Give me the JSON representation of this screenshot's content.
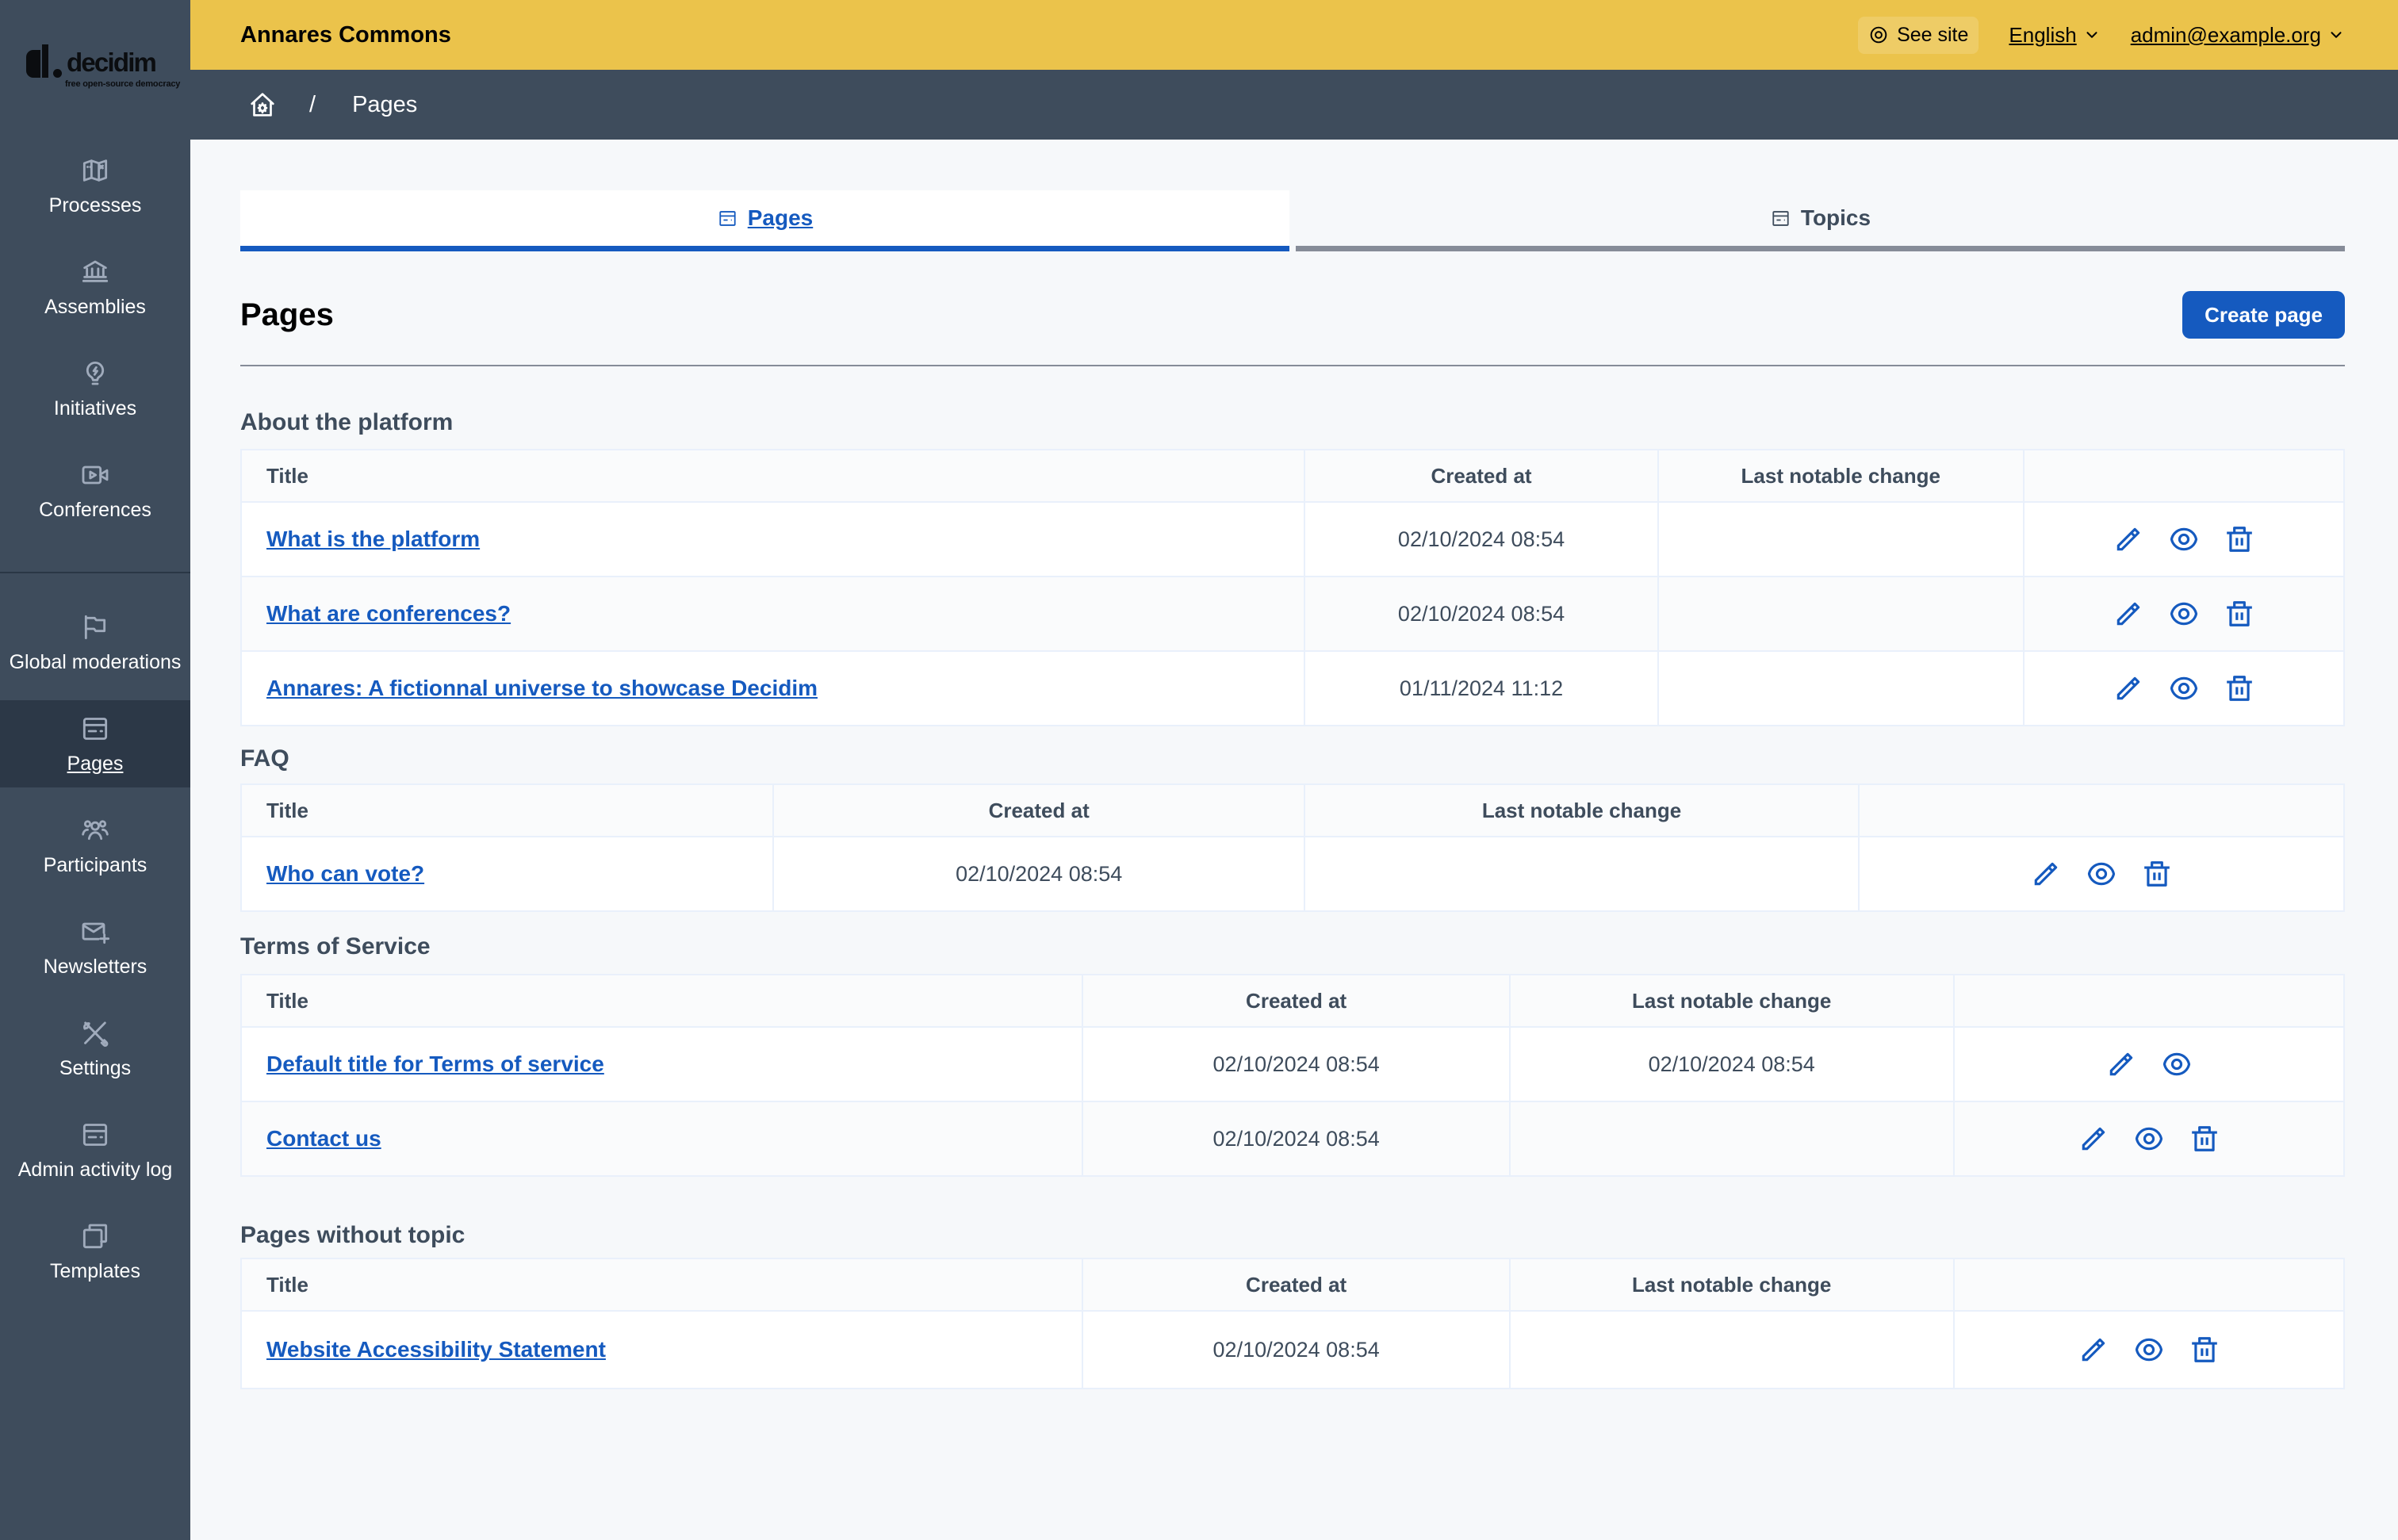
{
  "logo": {
    "brand": "decidim",
    "tagline": "free open-source democracy"
  },
  "topbar": {
    "title": "Annares Commons",
    "see_site": "See site",
    "language": "English",
    "user": "admin@example.org"
  },
  "breadcrumb": {
    "current": "Pages"
  },
  "sidebar": {
    "groups": [
      [
        {
          "id": "processes",
          "label": "Processes",
          "icon": "map"
        },
        {
          "id": "assemblies",
          "label": "Assemblies",
          "icon": "bank"
        },
        {
          "id": "initiatives",
          "label": "Initiatives",
          "icon": "lightbulb"
        },
        {
          "id": "conferences",
          "label": "Conferences",
          "icon": "video"
        }
      ],
      [
        {
          "id": "global-moderations",
          "label": "Global moderations",
          "icon": "flag"
        },
        {
          "id": "pages",
          "label": "Pages",
          "icon": "layout",
          "active": true
        },
        {
          "id": "participants",
          "label": "Participants",
          "icon": "team"
        },
        {
          "id": "newsletters",
          "label": "Newsletters",
          "icon": "mail-add"
        },
        {
          "id": "settings",
          "label": "Settings",
          "icon": "tools"
        },
        {
          "id": "admin-activity-log",
          "label": "Admin activity log",
          "icon": "layout"
        },
        {
          "id": "templates",
          "label": "Templates",
          "icon": "copy"
        }
      ]
    ]
  },
  "tabs": [
    {
      "label": "Pages",
      "active": true
    },
    {
      "label": "Topics",
      "active": false
    }
  ],
  "page": {
    "title": "Pages",
    "create_button": "Create page"
  },
  "sections": [
    {
      "heading": "About the platform",
      "columns": [
        "Title",
        "Created at",
        "Last notable change"
      ],
      "col_widths": [
        "50.57%",
        "16.81%",
        "17.37%",
        "15.25%"
      ],
      "rows": [
        {
          "title": "What is the platform",
          "created": "02/10/2024 08:54",
          "changed": "",
          "actions": [
            "edit",
            "preview",
            "delete"
          ]
        },
        {
          "title": "What are conferences?",
          "created": "02/10/2024 08:54",
          "changed": "",
          "actions": [
            "edit",
            "preview",
            "delete"
          ]
        },
        {
          "title": "Annares: A fictionnal universe to showcase Decidim",
          "created": "01/11/2024 11:12",
          "changed": "",
          "actions": [
            "edit",
            "preview",
            "delete"
          ]
        }
      ]
    },
    {
      "heading": "FAQ",
      "columns": [
        "Title",
        "Created at",
        "Last notable change"
      ],
      "col_widths": [
        "25.32%",
        "25.24%",
        "26.37%",
        "23.07%"
      ],
      "rows": [
        {
          "title": "Who can vote?",
          "created": "02/10/2024 08:54",
          "changed": "",
          "actions": [
            "edit",
            "preview",
            "delete"
          ]
        }
      ]
    },
    {
      "heading": "Terms of Service",
      "columns": [
        "Title",
        "Created at",
        "Last notable change"
      ],
      "col_widths": [
        "40.02%",
        "20.31%",
        "21.10%",
        "18.57%"
      ],
      "rows": [
        {
          "title": "Default title for Terms of service",
          "created": "02/10/2024 08:54",
          "changed": "02/10/2024 08:54",
          "actions": [
            "edit",
            "preview"
          ]
        },
        {
          "title": "Contact us",
          "created": "02/10/2024 08:54",
          "changed": "",
          "actions": [
            "edit",
            "preview",
            "delete"
          ]
        }
      ]
    },
    {
      "heading": "Pages without topic",
      "columns": [
        "Title",
        "Created at",
        "Last notable change"
      ],
      "col_widths": [
        "40.02%",
        "20.31%",
        "21.10%",
        "18.57%"
      ],
      "rows": [
        {
          "title": "Website Accessibility Statement",
          "created": "02/10/2024 08:54",
          "changed": "",
          "actions": [
            "edit",
            "preview",
            "delete"
          ]
        }
      ]
    }
  ],
  "colors": {
    "sidebar": "#3e4c5c",
    "sidebar_active": "#2c3847",
    "topbar": "#ebc34b",
    "see_site_bg": "#eecc66",
    "accent_blue": "#155abf",
    "content_bg": "#f6f8fa",
    "table_border": "#e9f0fb",
    "header_row_bg": "#fafbfc"
  }
}
